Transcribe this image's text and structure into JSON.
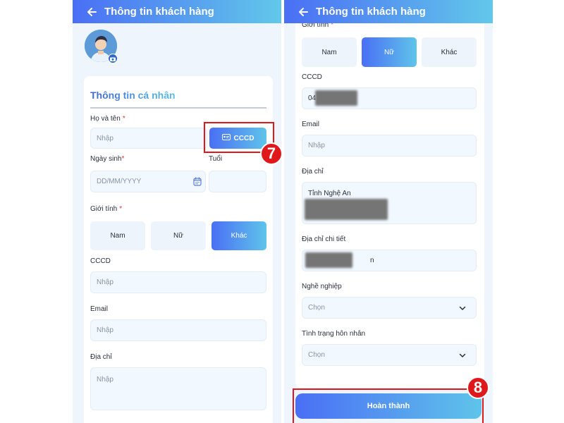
{
  "left_screen": {
    "header_title": "Thông tin khách hàng",
    "section_title": "Thông tin cá nhân",
    "full_name": {
      "label": "Họ và tên",
      "required": "*",
      "placeholder": "Nhập"
    },
    "cccd_button": "CCCD",
    "step_badge": "7",
    "birth_date": {
      "label": "Ngày sinh",
      "required": "*",
      "placeholder": "DD/MM/YYYY"
    },
    "age": {
      "label": "Tuổi",
      "value": ""
    },
    "gender": {
      "label": "Giới tính",
      "required": "*",
      "options": [
        "Nam",
        "Nữ",
        "Khác"
      ],
      "selected": "Khác"
    },
    "cccd": {
      "label": "CCCD",
      "placeholder": "Nhập"
    },
    "email": {
      "label": "Email",
      "placeholder": "Nhập"
    },
    "address": {
      "label": "Địa chỉ",
      "placeholder": "Nhập"
    }
  },
  "right_screen": {
    "header_title": "Thông tin khách hàng",
    "gender": {
      "label": "Giới tính",
      "required": "*",
      "options": [
        "Nam",
        "Nữ",
        "Khác"
      ],
      "selected": "Nữ"
    },
    "cccd": {
      "label": "CCCD",
      "value_prefix": "04"
    },
    "email": {
      "label": "Email",
      "placeholder": "Nhập"
    },
    "address": {
      "label": "Địa chỉ",
      "value": "Tỉnh Nghệ An"
    },
    "address_detail": {
      "label": "Địa chỉ chi tiết",
      "value_suffix": "n"
    },
    "occupation": {
      "label": "Nghề nghiệp",
      "placeholder": "Chọn"
    },
    "marital_status": {
      "label": "Tình trạng hôn nhân",
      "placeholder": "Chọn"
    },
    "submit_button": "Hoàn thành",
    "step_badge": "8"
  },
  "colors": {
    "accent_start": "#4a6ff5",
    "accent_end": "#5fc4ea",
    "highlight_red": "#e0181b",
    "required_red": "#e53935"
  }
}
